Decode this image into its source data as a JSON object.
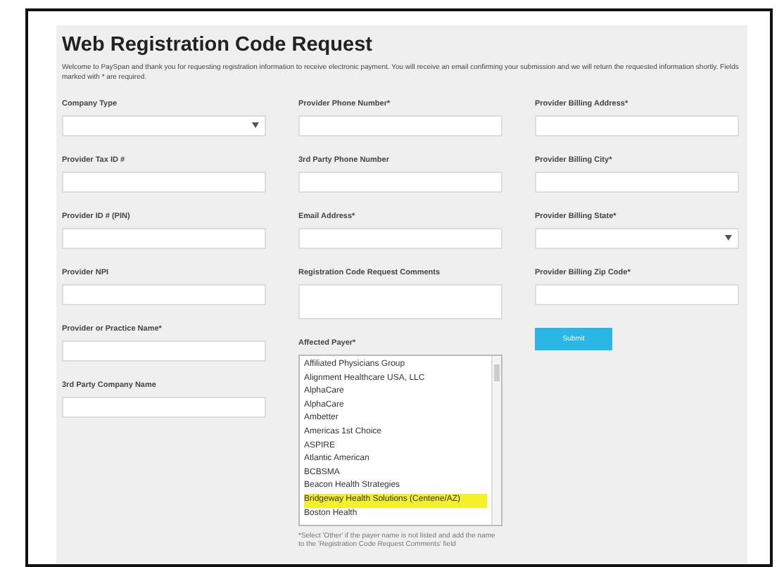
{
  "title": "Web Registration Code Request",
  "intro": "Welcome to PaySpan and thank you for requesting registration information to receive electronic payment. You will receive an email confirming your submission and we will return the requested information shortly. Fields marked with * are required.",
  "columns": [
    [
      {
        "kind": "select",
        "label": "Company Type"
      },
      {
        "kind": "text",
        "label": "Provider Tax ID #"
      },
      {
        "kind": "text",
        "label": "Provider ID # (PIN)"
      },
      {
        "kind": "text",
        "label": "Provider NPI"
      },
      {
        "kind": "text",
        "label": "Provider or Practice Name*"
      },
      {
        "kind": "text",
        "label": "3rd Party Company Name"
      }
    ],
    [
      {
        "kind": "text",
        "label": "Provider Phone Number*"
      },
      {
        "kind": "text",
        "label": "3rd Party Phone Number"
      },
      {
        "kind": "text",
        "label": "Email Address*"
      },
      {
        "kind": "textarea",
        "label": "Registration Code Request Comments"
      },
      {
        "kind": "listbox",
        "label": "Affected Payer*",
        "items": [
          {
            "text": "Affiliated Physicians Group",
            "selected": false
          },
          {
            "text": "Alignment Healthcare USA, LLC",
            "selected": false
          },
          {
            "text": "AlphaCare",
            "selected": false
          },
          {
            "text": "AlphaCare",
            "selected": false
          },
          {
            "text": "Ambetter",
            "selected": false
          },
          {
            "text": "Americas 1st Choice",
            "selected": false
          },
          {
            "text": "ASPIRE",
            "selected": false
          },
          {
            "text": "Atlantic American",
            "selected": false
          },
          {
            "text": "BCBSMA",
            "selected": false
          },
          {
            "text": "Beacon Health Strategies",
            "selected": false
          },
          {
            "text": "Bridgeway Health Solutions (Centene/AZ)",
            "selected": true
          },
          {
            "text": "Boston Health",
            "selected": false
          }
        ]
      },
      {
        "kind": "note",
        "text": "*Select 'Other' if the payer name is not listed and add the name to the 'Registration Code Request Comments' field"
      }
    ],
    [
      {
        "kind": "text",
        "label": "Provider Billing Address*"
      },
      {
        "kind": "text",
        "label": "Provider Billing City*"
      },
      {
        "kind": "select",
        "label": "Provider Billing State*"
      },
      {
        "kind": "text",
        "label": "Provider Billing Zip Code*"
      },
      {
        "kind": "button",
        "label": "Submit"
      }
    ]
  ]
}
